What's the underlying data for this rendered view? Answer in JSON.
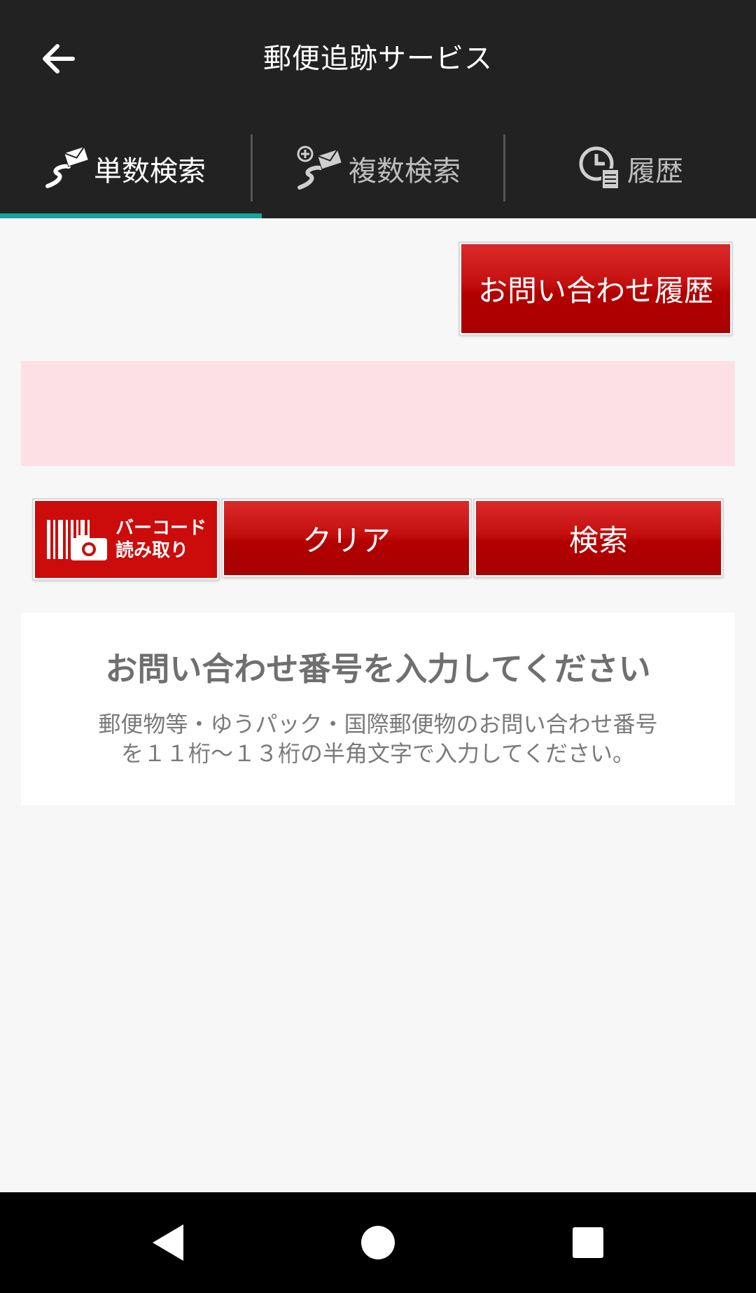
{
  "appbar": {
    "title": "郵便追跡サービス",
    "back_icon": "arrow-left-icon"
  },
  "tabs": [
    {
      "label": "単数検索",
      "icon": "single-search-icon",
      "active": true
    },
    {
      "label": "複数検索",
      "icon": "multi-search-icon",
      "active": false
    },
    {
      "label": "履歴",
      "icon": "history-icon",
      "active": false
    }
  ],
  "actions": {
    "history_button": "お問い合わせ履歴",
    "barcode_line1": "バーコード",
    "barcode_line2": "読み取り",
    "clear_button": "クリア",
    "search_button": "検索"
  },
  "input": {
    "value": "",
    "placeholder": ""
  },
  "info": {
    "title": "お問い合わせ番号を入力してください",
    "description_line1": "郵便物等・ゆうパック・国際郵便物のお問い合わせ番号",
    "description_line2": "を１１桁～１３桁の半角文字で入力してください。"
  },
  "colors": {
    "appbar": "#222222",
    "tab_indicator": "#14a69a",
    "button_red": "#c40f0f",
    "input_background": "#fce0e6"
  }
}
